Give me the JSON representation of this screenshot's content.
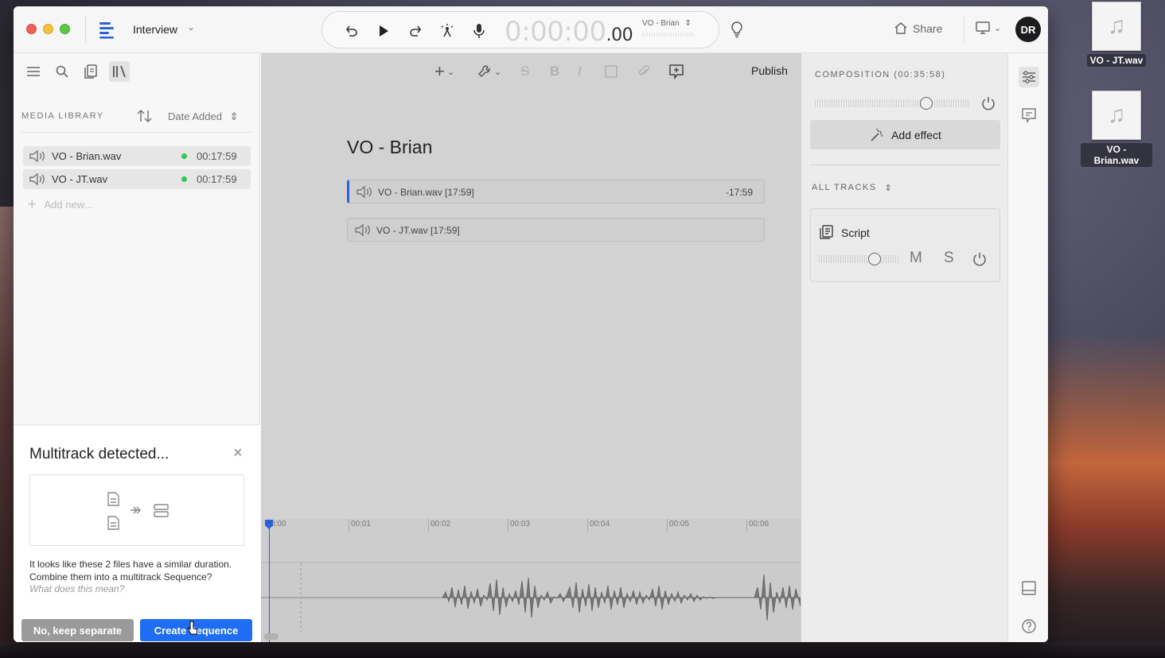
{
  "desktop": {
    "icons": [
      {
        "label": "VO - JT.wav"
      },
      {
        "label": "VO - Brian.wav"
      }
    ]
  },
  "header": {
    "project_title": "Interview",
    "timecode_main": "0:00:00",
    "timecode_ms": ".00",
    "track_selector": "VO - Brian",
    "share_label": "Share",
    "avatar_initials": "DR"
  },
  "library": {
    "title": "MEDIA LIBRARY",
    "sort_label": "Date Added",
    "items": [
      {
        "name": "VO - Brian.wav",
        "duration": "00:17:59"
      },
      {
        "name": "VO - JT.wav",
        "duration": "00:17:59"
      }
    ],
    "add_new": "Add new..."
  },
  "multitrack": {
    "title": "Multitrack detected...",
    "body": "It looks like these 2 files have a similar duration. Combine them into a multitrack Sequence?",
    "help": "What does this mean?",
    "keep_separate": "No, keep separate",
    "create": "Create Sequence"
  },
  "editor": {
    "publish": "Publish",
    "doc_title": "VO - Brian",
    "clips": [
      {
        "name": "VO - Brian.wav  [17:59]",
        "length": "-17:59"
      },
      {
        "name": "VO - JT.wav  [17:59]",
        "length": ""
      }
    ]
  },
  "timeline": {
    "ticks": [
      "0:00",
      "00:01",
      "00:02",
      "00:03",
      "00:04",
      "00:05",
      "00:06"
    ]
  },
  "right_panel": {
    "composition": "COMPOSITION (00:35:58)",
    "add_effect": "Add effect",
    "all_tracks": "ALL TRACKS",
    "track_name": "Script",
    "mute": "M",
    "solo": "S"
  },
  "colors": {
    "accent": "#1f6df2",
    "playhead": "#2a63d9",
    "status_green": "#34c759"
  }
}
